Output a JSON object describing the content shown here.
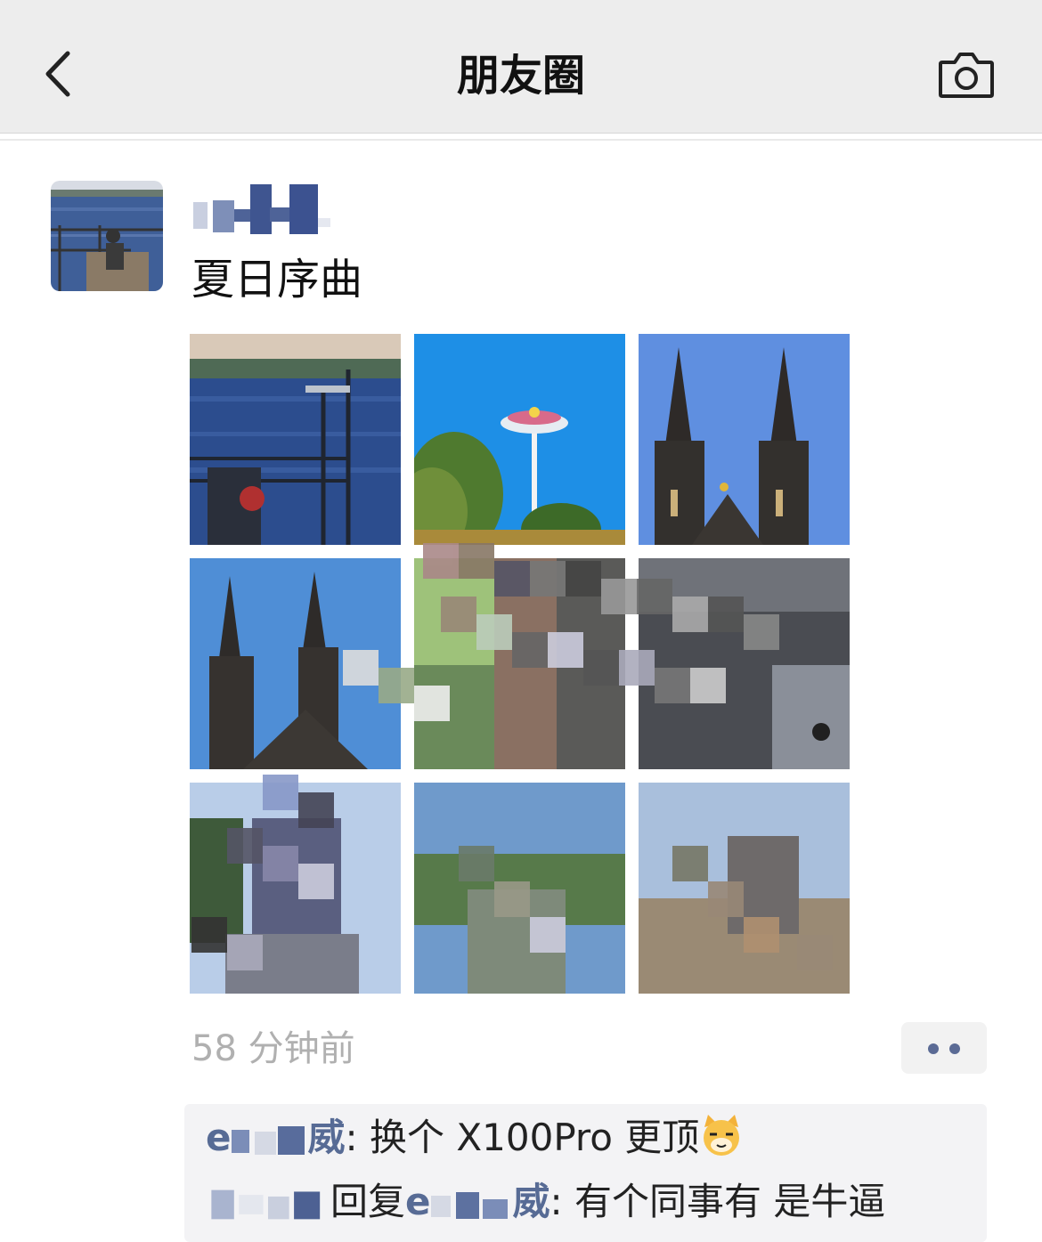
{
  "nav": {
    "title": "朋友圈",
    "back_icon": "chevron-left-icon",
    "camera_icon": "camera-icon"
  },
  "post": {
    "text": "夏日序曲",
    "time": "58 分钟前",
    "more_icon": "more-dots-icon",
    "photos": [
      {
        "subject": "lake with railing"
      },
      {
        "subject": "ferris tower against blue sky"
      },
      {
        "subject": "cathedral twin spires"
      },
      {
        "subject": "cathedral spires side view"
      },
      {
        "subject": "person with plants (pixelated)"
      },
      {
        "subject": "cathedral facade (pixelated)"
      },
      {
        "subject": "selfie (pixelated)"
      },
      {
        "subject": "people outdoors (pixelated)"
      },
      {
        "subject": "people on steps (pixelated)"
      }
    ]
  },
  "comments": [
    {
      "author_visible": "e",
      "author_tail": "威",
      "sep": ": ",
      "body": "换个 X100Pro 更顶",
      "emoji": "cat-smirk-emoji"
    },
    {
      "reply_label": "回复",
      "target_visible": "e",
      "target_tail": "威",
      "sep": ": ",
      "body": "有个同事有 是牛逼"
    }
  ],
  "colors": {
    "navbar_bg": "#ededed",
    "nickname": "#576b95",
    "timestamp": "#b0b0b0",
    "comment_bg": "#f3f3f5"
  }
}
